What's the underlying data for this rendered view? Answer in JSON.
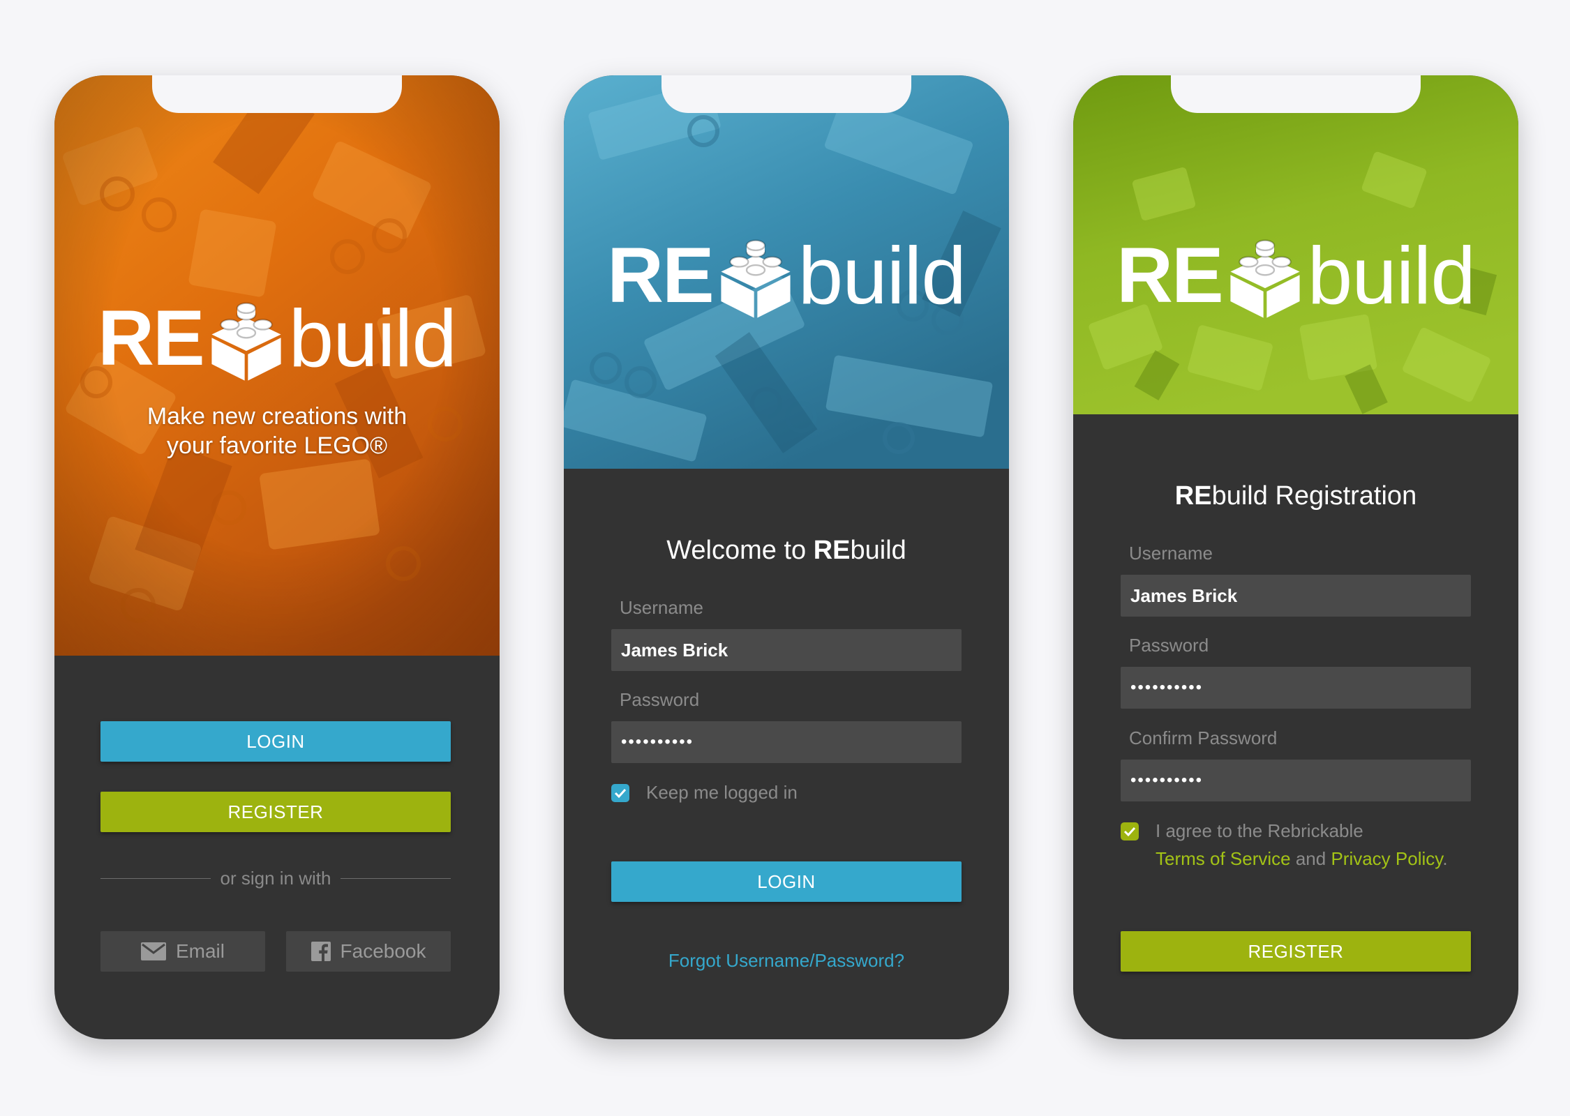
{
  "brand": {
    "re": "RE",
    "build": "build"
  },
  "screen1": {
    "tagline_line1": "Make new creations with",
    "tagline_line2": "your favorite LEGO®",
    "login_label": "LOGIN",
    "register_label": "REGISTER",
    "divider_text": "or sign in with",
    "email_label": "Email",
    "facebook_label": "Facebook"
  },
  "screen2": {
    "title_prefix": "Welcome to ",
    "title_re": "RE",
    "title_build": "build",
    "username_label": "Username",
    "username_value": "James Brick",
    "password_label": "Password",
    "password_value": "••••••••••",
    "keep_logged_label": "Keep me logged in",
    "keep_logged_checked": true,
    "login_label": "LOGIN",
    "forgot_label": "Forgot Username/Password?"
  },
  "screen3": {
    "title_re": "RE",
    "title_rest": "build Registration",
    "username_label": "Username",
    "username_value": "James Brick",
    "password_label": "Password",
    "password_value": "••••••••••",
    "confirm_label": "Confirm Password",
    "confirm_value": "••••••••••",
    "agree_text": "I agree to the Rebrickable",
    "tos_label": "Terms of Service",
    "and_text": " and ",
    "privacy_label": "Privacy Policy",
    "period": ".",
    "agree_checked": true,
    "register_label": "REGISTER"
  },
  "colors": {
    "accent_blue": "#35a8cc",
    "accent_green": "#9db30f",
    "panel": "#333333",
    "field": "#4a4a4a",
    "hero_orange": "#e8730f",
    "hero_blue": "#3f8fb0",
    "hero_green": "#8db31c"
  },
  "icons": [
    "brick-logo-icon",
    "email-icon",
    "facebook-icon",
    "checkmark-icon"
  ]
}
